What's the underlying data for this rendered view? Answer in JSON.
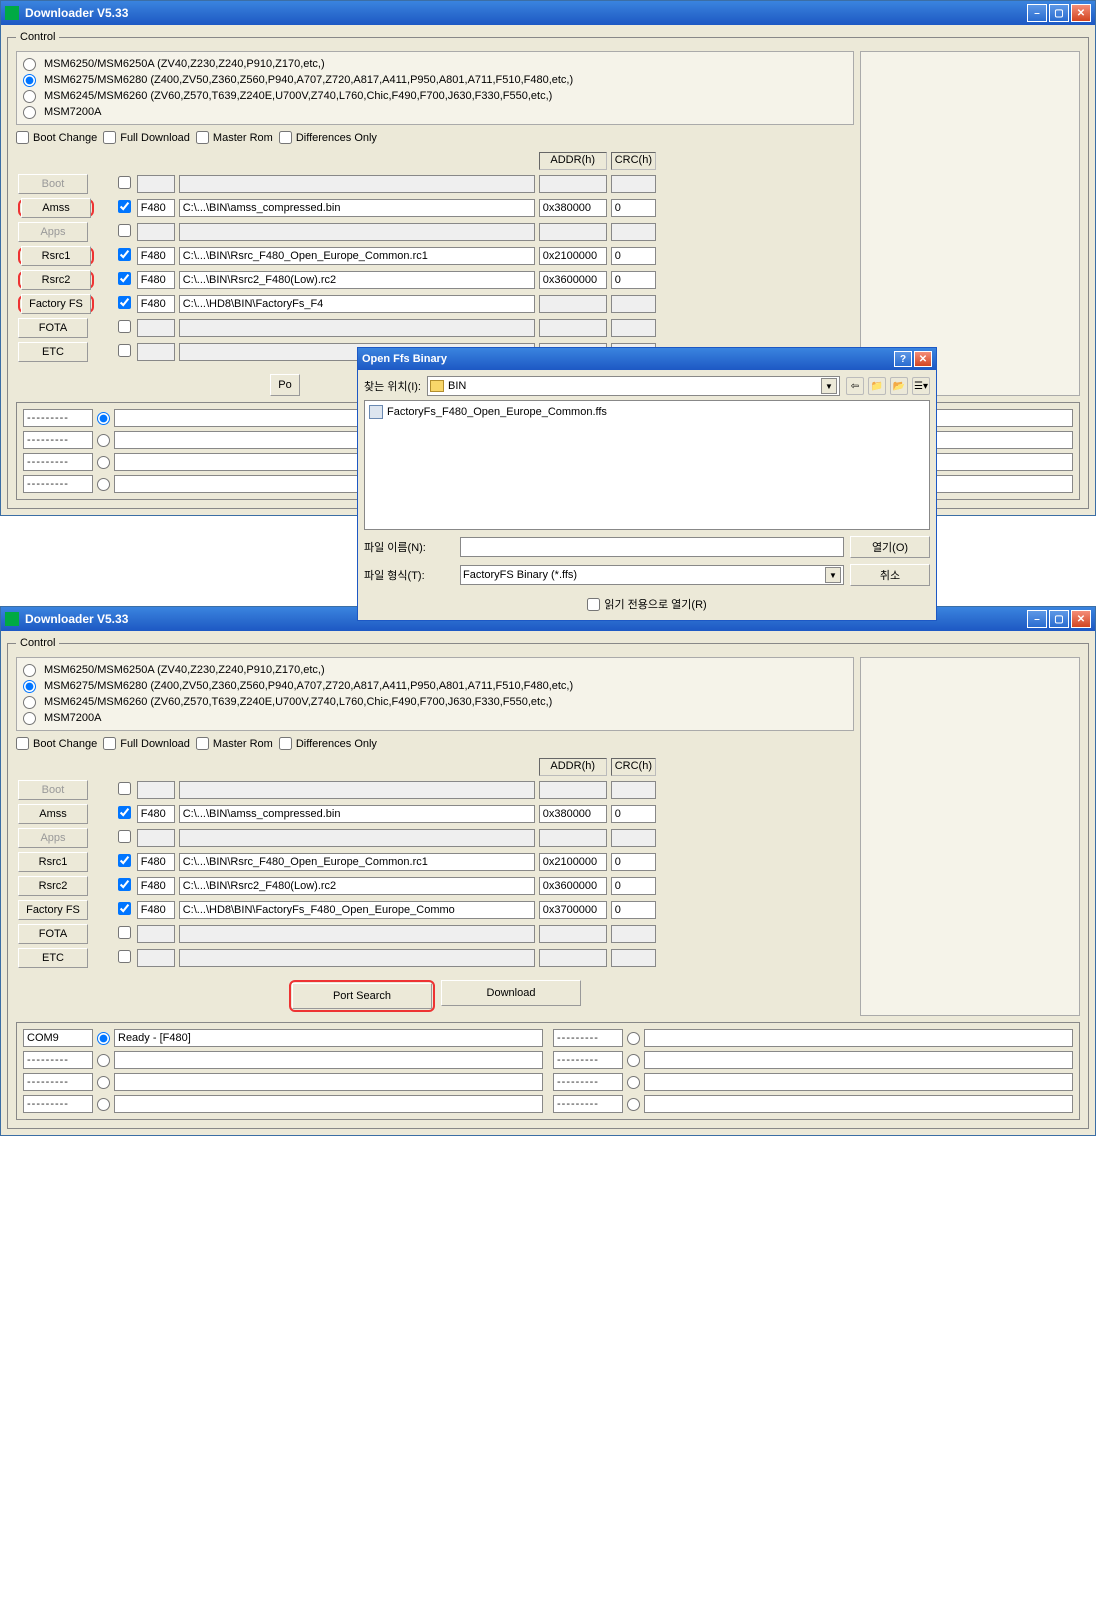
{
  "win1": {
    "title": "Downloader V5.33",
    "control_legend": "Control",
    "chips": [
      {
        "selected": false,
        "label": "MSM6250/MSM6250A (ZV40,Z230,Z240,P910,Z170,etc,)"
      },
      {
        "selected": true,
        "label": "MSM6275/MSM6280 (Z400,ZV50,Z360,Z560,P940,A707,Z720,A817,A411,P950,A801,A711,F510,F480,etc,)"
      },
      {
        "selected": false,
        "label": "MSM6245/MSM6260 (ZV60,Z570,T639,Z240E,U700V,Z740,L760,Chic,F490,F700,J630,F330,F550,etc,)"
      },
      {
        "selected": false,
        "label": "MSM7200A"
      }
    ],
    "checks": {
      "boot_change": "Boot Change",
      "full_download": "Full Download",
      "master_rom": "Master Rom",
      "diff_only": "Differences Only"
    },
    "headers": {
      "addr": "ADDR(h)",
      "crc": "CRC(h)"
    },
    "rows": [
      {
        "btn": "Boot",
        "disabled": true,
        "red": false,
        "chk": false,
        "code": "",
        "path": "",
        "addr": "",
        "crc": ""
      },
      {
        "btn": "Amss",
        "disabled": false,
        "red": true,
        "chk": true,
        "code": "F480",
        "path": "C:\\...\\BIN\\amss_compressed.bin",
        "addr": "0x380000",
        "crc": "0"
      },
      {
        "btn": "Apps",
        "disabled": true,
        "red": false,
        "chk": false,
        "code": "",
        "path": "",
        "addr": "",
        "crc": ""
      },
      {
        "btn": "Rsrc1",
        "disabled": false,
        "red": true,
        "chk": true,
        "code": "F480",
        "path": "C:\\...\\BIN\\Rsrc_F480_Open_Europe_Common.rc1",
        "addr": "0x2100000",
        "crc": "0"
      },
      {
        "btn": "Rsrc2",
        "disabled": false,
        "red": true,
        "chk": true,
        "code": "F480",
        "path": "C:\\...\\BIN\\Rsrc2_F480(Low).rc2",
        "addr": "0x3600000",
        "crc": "0"
      },
      {
        "btn": "Factory FS",
        "disabled": false,
        "red": true,
        "chk": true,
        "code": "F480",
        "path": "C:\\...\\HD8\\BIN\\FactoryFs_F4",
        "addr": "",
        "crc": ""
      },
      {
        "btn": "FOTA",
        "disabled": false,
        "red": false,
        "chk": false,
        "code": "",
        "path": "",
        "addr": "",
        "crc": ""
      },
      {
        "btn": "ETC",
        "disabled": false,
        "red": false,
        "chk": false,
        "code": "",
        "path": "",
        "addr": "",
        "crc": ""
      }
    ],
    "po_label": "Po",
    "placeholder": "---------",
    "ports": [
      {
        "port": "---------",
        "sel": true,
        "status": ""
      },
      {
        "port": "---------",
        "sel": false,
        "status": ""
      },
      {
        "port": "---------",
        "sel": false,
        "status": ""
      },
      {
        "port": "---------",
        "sel": false,
        "status": ""
      },
      {
        "port": "---------",
        "sel": false,
        "status": ""
      },
      {
        "port": "---------",
        "sel": false,
        "status": ""
      },
      {
        "port": "---------",
        "sel": false,
        "status": ""
      },
      {
        "port": "---------",
        "sel": false,
        "status": ""
      }
    ]
  },
  "filedlg": {
    "title": "Open Ffs Binary",
    "lookin_label": "찾는 위치(I):",
    "folder": "BIN",
    "file": "FactoryFs_F480_Open_Europe_Common.ffs",
    "fname_label": "파일 이름(N):",
    "fname_value": "",
    "ftype_label": "파일 형식(T):",
    "ftype_value": "FactoryFS Binary (*.ffs)",
    "open_btn": "열기(O)",
    "cancel_btn": "취소",
    "readonly_label": "읽기 전용으로 열기(R)"
  },
  "win2": {
    "title": "Downloader V5.33",
    "control_legend": "Control",
    "chips": [
      {
        "selected": false,
        "label": "MSM6250/MSM6250A (ZV40,Z230,Z240,P910,Z170,etc,)"
      },
      {
        "selected": true,
        "label": "MSM6275/MSM6280 (Z400,ZV50,Z360,Z560,P940,A707,Z720,A817,A411,P950,A801,A711,F510,F480,etc,)"
      },
      {
        "selected": false,
        "label": "MSM6245/MSM6260 (ZV60,Z570,T639,Z240E,U700V,Z740,L760,Chic,F490,F700,J630,F330,F550,etc,)"
      },
      {
        "selected": false,
        "label": "MSM7200A"
      }
    ],
    "checks": {
      "boot_change": "Boot Change",
      "full_download": "Full Download",
      "master_rom": "Master Rom",
      "diff_only": "Differences Only"
    },
    "headers": {
      "addr": "ADDR(h)",
      "crc": "CRC(h)"
    },
    "rows": [
      {
        "btn": "Boot",
        "disabled": true,
        "red": false,
        "chk": false,
        "code": "",
        "path": "",
        "addr": "",
        "crc": ""
      },
      {
        "btn": "Amss",
        "disabled": false,
        "red": false,
        "chk": true,
        "code": "F480",
        "path": "C:\\...\\BIN\\amss_compressed.bin",
        "addr": "0x380000",
        "crc": "0"
      },
      {
        "btn": "Apps",
        "disabled": true,
        "red": false,
        "chk": false,
        "code": "",
        "path": "",
        "addr": "",
        "crc": ""
      },
      {
        "btn": "Rsrc1",
        "disabled": false,
        "red": false,
        "chk": true,
        "code": "F480",
        "path": "C:\\...\\BIN\\Rsrc_F480_Open_Europe_Common.rc1",
        "addr": "0x2100000",
        "crc": "0"
      },
      {
        "btn": "Rsrc2",
        "disabled": false,
        "red": false,
        "chk": true,
        "code": "F480",
        "path": "C:\\...\\BIN\\Rsrc2_F480(Low).rc2",
        "addr": "0x3600000",
        "crc": "0"
      },
      {
        "btn": "Factory FS",
        "disabled": false,
        "red": false,
        "chk": true,
        "code": "F480",
        "path": "C:\\...\\HD8\\BIN\\FactoryFs_F480_Open_Europe_Commo",
        "addr": "0x3700000",
        "crc": "0"
      },
      {
        "btn": "FOTA",
        "disabled": false,
        "red": false,
        "chk": false,
        "code": "",
        "path": "",
        "addr": "",
        "crc": ""
      },
      {
        "btn": "ETC",
        "disabled": false,
        "red": false,
        "chk": false,
        "code": "",
        "path": "",
        "addr": "",
        "crc": ""
      }
    ],
    "port_search": "Port Search",
    "download": "Download",
    "placeholder": "---------",
    "ports": [
      {
        "port": "COM9",
        "sel": true,
        "status": "Ready - [F480]"
      },
      {
        "port": "---------",
        "sel": false,
        "status": ""
      },
      {
        "port": "---------",
        "sel": false,
        "status": ""
      },
      {
        "port": "---------",
        "sel": false,
        "status": ""
      },
      {
        "port": "---------",
        "sel": false,
        "status": ""
      },
      {
        "port": "---------",
        "sel": false,
        "status": ""
      },
      {
        "port": "---------",
        "sel": false,
        "status": ""
      },
      {
        "port": "---------",
        "sel": false,
        "status": ""
      }
    ]
  }
}
